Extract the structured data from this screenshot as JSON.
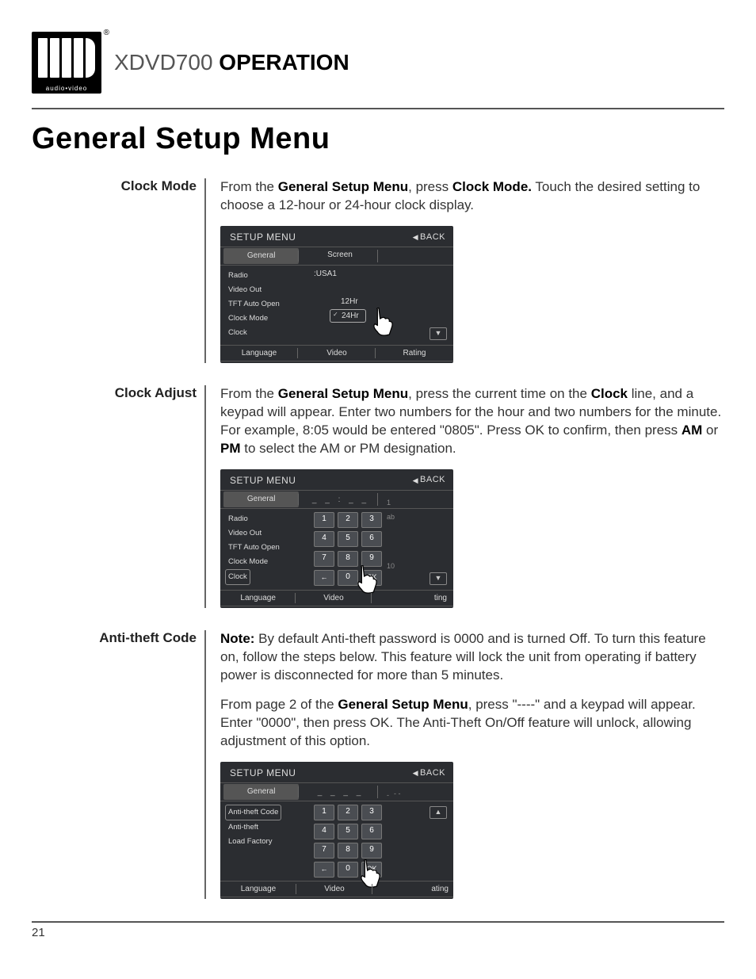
{
  "logo_sub": "audio•video",
  "product": {
    "model": "XDVD700",
    "op": "OPERATION"
  },
  "page_heading": "General Setup Menu",
  "sections": {
    "clock_mode": {
      "label": "Clock Mode",
      "text_pre": "From the ",
      "bold1": "General Setup Menu",
      "text_mid": ", press ",
      "bold2": "Clock Mode.",
      "text_post": " Touch the desired setting to choose a 12-hour or 24-hour clock display."
    },
    "clock_adjust": {
      "label": "Clock Adjust",
      "text_pre": "From the ",
      "bold1": "General Setup Menu",
      "text_mid1": ", press the current time on the ",
      "bold2": "Clock",
      "text_mid2": " line, and a keypad will appear. Enter two numbers for the hour and two numbers for the minute. For example, 8:05 would be entered \"0805\". Press OK to confirm, then press ",
      "bold3": "AM",
      "text_or": " or ",
      "bold4": "PM",
      "text_post": " to select the AM or PM designation."
    },
    "anti_theft": {
      "label": "Anti-theft Code",
      "note_label": "Note:",
      "note_text": " By default Anti-theft password is 0000 and is turned Off. To turn this feature on, follow the steps below. This feature will lock the unit from operating if battery power is disconnected for more than 5 minutes.",
      "p2_pre": "From page 2 of the ",
      "p2_bold": "General Setup Menu",
      "p2_post": ", press \"----\" and a keypad will appear. Enter \"0000\", then press OK. The Anti-Theft On/Off feature will unlock, allowing adjustment of this option."
    }
  },
  "ss_common": {
    "title": "SETUP MENU",
    "back": "BACK",
    "tab_general": "General",
    "tab_screen": "Screen",
    "tab_language": "Language",
    "tab_video": "Video",
    "tab_rating": "Rating"
  },
  "ss1": {
    "left": [
      "Radio",
      "Video Out",
      "TFT Auto Open",
      "Clock Mode",
      "Clock"
    ],
    "right_label": ":USA1",
    "opt1": "12Hr",
    "opt2": "24Hr"
  },
  "ss2": {
    "left": [
      "Radio",
      "Video Out",
      "TFT Auto Open",
      "Clock Mode",
      "Clock"
    ],
    "time_display": "_ _ : _ _",
    "keys": [
      "1",
      "2",
      "3",
      "4",
      "5",
      "6",
      "7",
      "8",
      "9",
      "←",
      "0",
      "OK"
    ],
    "extra1": "1",
    "extra2": "ab",
    "extra3": "10"
  },
  "ss3": {
    "left": [
      "Anti-theft Code",
      "Anti-theft",
      "Load Factory"
    ],
    "time_display": "_ _ _ _",
    "keys": [
      "1",
      "2",
      "3",
      "4",
      "5",
      "6",
      "7",
      "8",
      "9",
      "←",
      "0",
      "OK"
    ],
    "extra1": "-",
    "extra2": "- -"
  },
  "page_number": "21"
}
